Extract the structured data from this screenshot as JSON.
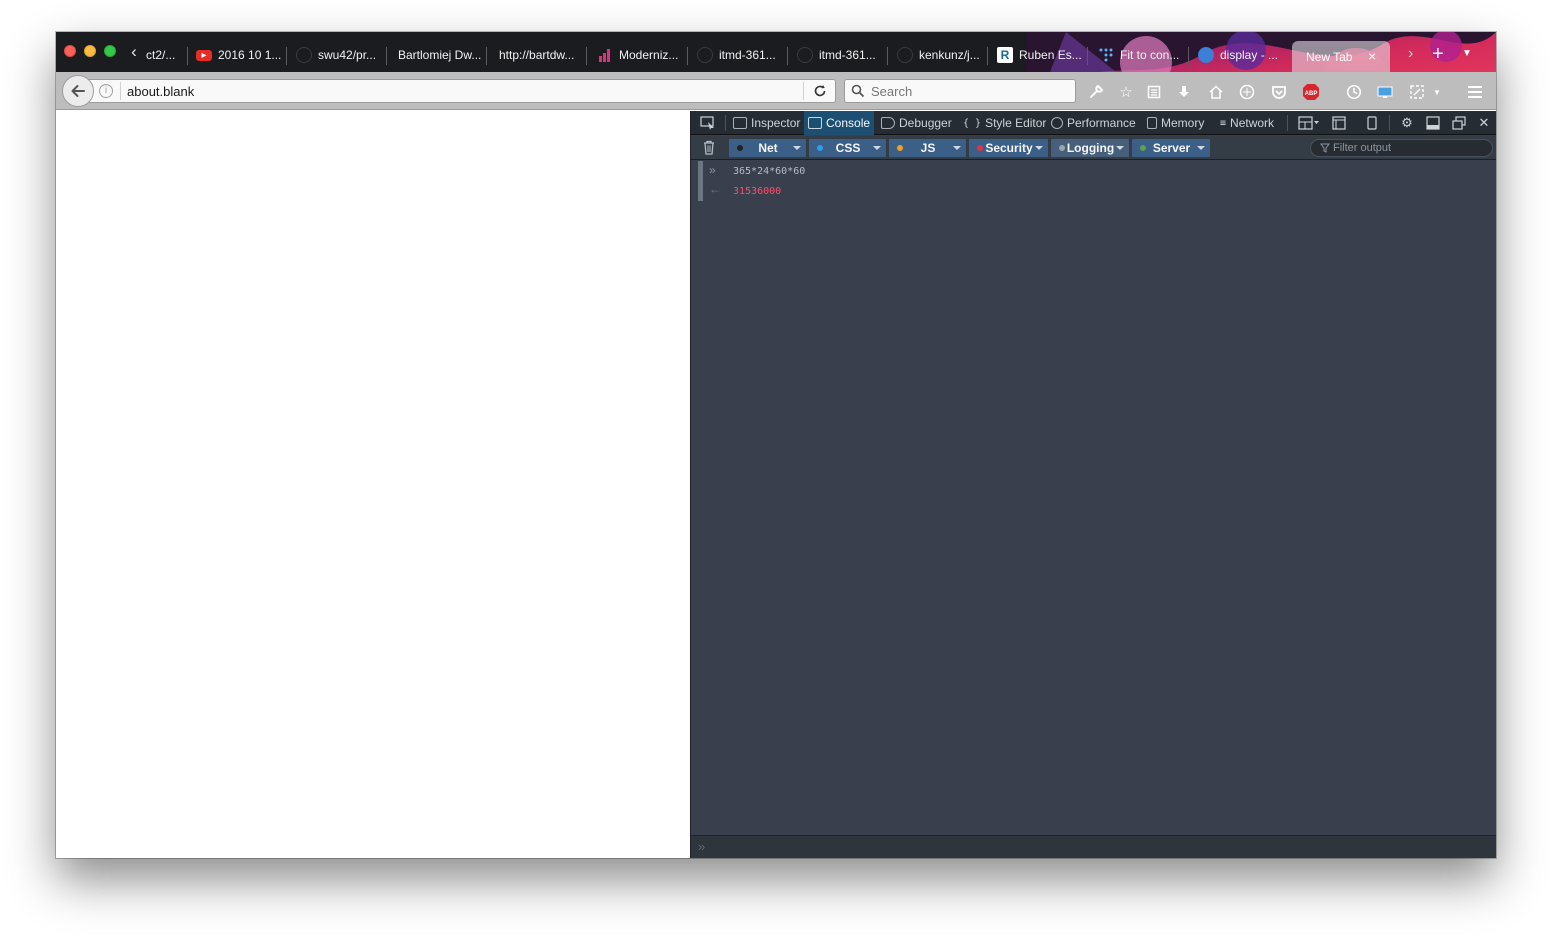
{
  "tabs": [
    {
      "title": "ct2/...",
      "icon": "none"
    },
    {
      "title": "2016 10 1...",
      "icon": "youtube-icon"
    },
    {
      "title": "swu42/pr...",
      "icon": "github-icon"
    },
    {
      "title": "Bartlomiej Dw...",
      "icon": "none"
    },
    {
      "title": "http://bartdw...",
      "icon": "none"
    },
    {
      "title": "Moderniz...",
      "icon": "chart-icon"
    },
    {
      "title": "itmd-361...",
      "icon": "github-icon"
    },
    {
      "title": "itmd-361...",
      "icon": "github-icon"
    },
    {
      "title": "kenkunz/j...",
      "icon": "github-icon"
    },
    {
      "title": "Ruben Es...",
      "icon": "r-logo-icon"
    },
    {
      "title": "Fit to con...",
      "icon": "dots-icon"
    },
    {
      "title": "display - ...",
      "icon": "chrome-icon"
    }
  ],
  "active_tab": {
    "title": "New Tab"
  },
  "navbar": {
    "url": "about.blank",
    "search_placeholder": "Search"
  },
  "devtools": {
    "tabs": [
      "Inspector",
      "Console",
      "Debugger",
      "Style Editor",
      "Performance",
      "Memory",
      "Network"
    ],
    "selected_tab": "Console",
    "filters": [
      {
        "label": "Net",
        "dot_color": "#222222"
      },
      {
        "label": "CSS",
        "dot_color": "#2aa0e8"
      },
      {
        "label": "JS",
        "dot_color": "#f0a020"
      },
      {
        "label": "Security",
        "dot_color": "#e0304a"
      },
      {
        "label": "Logging",
        "dot_color": "#9aa4b0"
      },
      {
        "label": "Server",
        "dot_color": "#5aa050"
      }
    ],
    "filter_output_placeholder": "Filter output",
    "console": {
      "input": "365*24*60*60",
      "result": "31536000"
    }
  },
  "colors": {
    "accent_selected": "#1d4f73",
    "result_red": "#ff4d6a",
    "devtools_bg": "#393f4c"
  }
}
